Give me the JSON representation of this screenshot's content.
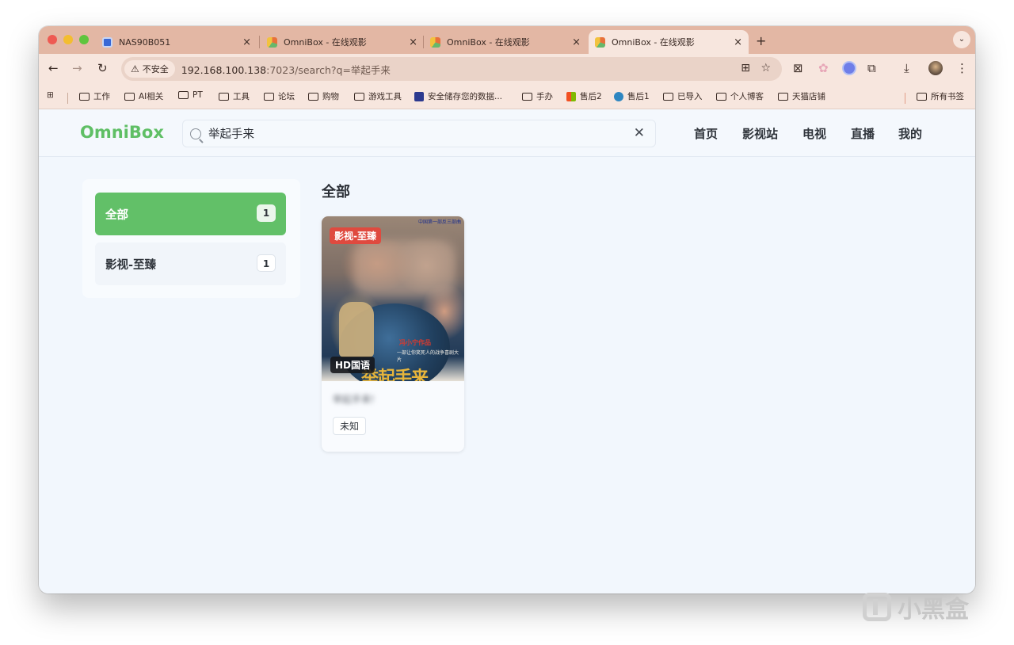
{
  "browser": {
    "tabs": [
      {
        "title": "NAS90B051",
        "close": "×"
      },
      {
        "title": "OmniBox - 在线观影",
        "close": "×"
      },
      {
        "title": "OmniBox - 在线观影",
        "close": "×"
      },
      {
        "title": "OmniBox - 在线观影",
        "close": "×"
      }
    ],
    "new_tab": "+",
    "tab_menu": "⌄",
    "security_label": "不安全",
    "url_host": "192.168.100.138",
    "url_rest": ":7023/search?q=举起手来",
    "bookmarks": [
      "工作",
      "AI相关",
      "PT",
      "工具",
      "论坛",
      "购物",
      "游戏工具",
      "安全储存您的数据...",
      "手办",
      "售后2",
      "售后1",
      "已导入",
      "个人博客",
      "天猫店铺"
    ],
    "all_bookmarks": "所有书签"
  },
  "app": {
    "logo": "OmniBox",
    "search": {
      "value": "举起手来",
      "clear": "✕"
    },
    "nav": [
      "首页",
      "影视站",
      "电视",
      "直播",
      "我的"
    ]
  },
  "sidebar": {
    "categories": [
      {
        "label": "全部",
        "count": "1",
        "active": true
      },
      {
        "label": "影视-至臻",
        "count": "1",
        "active": false
      }
    ]
  },
  "results": {
    "title": "全部",
    "cards": [
      {
        "source_badge": "影视-至臻",
        "quality_badge": "HD国语",
        "title": "举起手来!",
        "tag": "未知",
        "poster_top_text": "中国第一部反三部曲",
        "poster_red_text": "冯小宁作品",
        "poster_white_text": "一部让你笑死人的战争喜剧大片",
        "poster_big_title": "举起手来"
      }
    ]
  },
  "watermark": "小黑盒",
  "colors": {
    "brand_green": "#5fbf65",
    "active_category": "#62c068",
    "source_badge": "#df4a3f",
    "tab_strip": "#e3b7a4"
  }
}
